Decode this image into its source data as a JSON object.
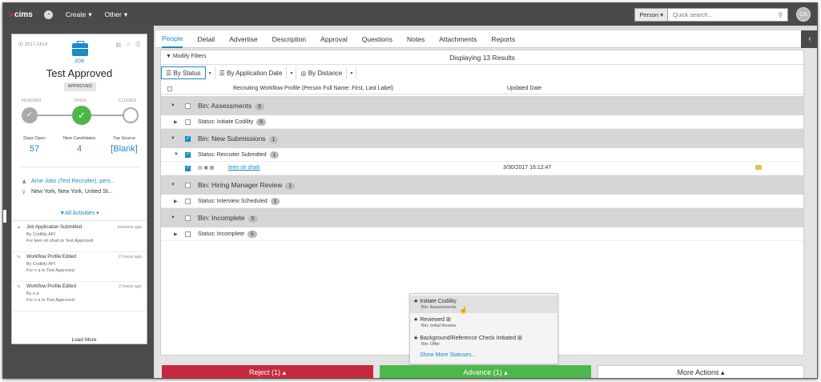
{
  "topbar": {
    "logo": "cims",
    "nav": [
      {
        "label": "Create"
      },
      {
        "label": "Other"
      }
    ],
    "person_select": "Person",
    "search_placeholder": "Quick search...",
    "avatar": "CA"
  },
  "record": {
    "id": "ID 2017-1614",
    "type": "JOB",
    "title": "Test Approved",
    "status": "APPROVED",
    "pipeline": {
      "pending": "PENDING",
      "open": "OPEN",
      "closed": "CLOSED"
    },
    "stats": [
      {
        "label": "Days Open",
        "value": "57"
      },
      {
        "label": "New Candidates",
        "value": "4"
      },
      {
        "label": "Top Source",
        "value": "[Blank]"
      }
    ],
    "owner": "Arne Jobs (Test Recruiter), pers...",
    "location": "New York, New York, United St...",
    "all_activities": "All Activities"
  },
  "activities": [
    {
      "title": "Job Application Submitted",
      "ago": "moment ago",
      "line2": "By Codility API",
      "line3": "For leen sh shah to Test Approved"
    },
    {
      "title": "Workflow Profile Edited",
      "ago": "2 hours ago",
      "line2": "By Codility API",
      "line3": "For n a to Test Approved"
    },
    {
      "title": "Workflow Profile Edited",
      "ago": "2 hours ago",
      "line2": "By n a",
      "line3": "For n a to Test Approved"
    }
  ],
  "load_more": "Load More",
  "tabs": [
    "People",
    "Detail",
    "Advertise",
    "Description",
    "Approval",
    "Questions",
    "Notes",
    "Attachments",
    "Reports"
  ],
  "filters": {
    "modify": "Modify Filters",
    "displaying": "Displaying 13 Results",
    "views": [
      "By Status",
      "By Application Date",
      "By Distance"
    ]
  },
  "columns": {
    "profile": "Recruiting Workflow Profile (Person Full Name: First, Last Label)",
    "updated": "Updated Date"
  },
  "rows": {
    "bin1": {
      "label": "Bin: Assessments",
      "count": "6"
    },
    "stat1": {
      "label": "Status: Initiate Codility",
      "count": "6"
    },
    "bin2": {
      "label": "Bin: New Submissions",
      "count": "1"
    },
    "stat2": {
      "label": "Status: Recruiter Submitted",
      "count": "1"
    },
    "cand": {
      "name": "leen sh shah",
      "date": "3/30/2017 16:12:47"
    },
    "bin3": {
      "label": "Bin: Hiring Manager Review",
      "count": "1"
    },
    "stat3": {
      "label": "Status: Interview Scheduled",
      "count": "1"
    },
    "bin4": {
      "label": "Bin: Incomplete",
      "count": "5"
    },
    "stat4": {
      "label": "Status: Incomplete",
      "count": "5"
    }
  },
  "popup": {
    "items": [
      {
        "title": "Initiate Codility",
        "bin": "Bin: Assessments"
      },
      {
        "title": "Reviewed",
        "bin": "Bin: Initial Review"
      },
      {
        "title": "Background/Reference Check Initiated",
        "bin": "Bin: Offer"
      }
    ],
    "show_more": "Show More Statuses..."
  },
  "actions": {
    "reject": "Reject (1) ▴",
    "advance": "Advance (1) ▴",
    "more": "More Actions ▴"
  },
  "colors": {
    "accent": "#1e88c8",
    "reject": "#c8283e",
    "advance": "#4cb84a",
    "topbar": "#4a4a4a"
  }
}
